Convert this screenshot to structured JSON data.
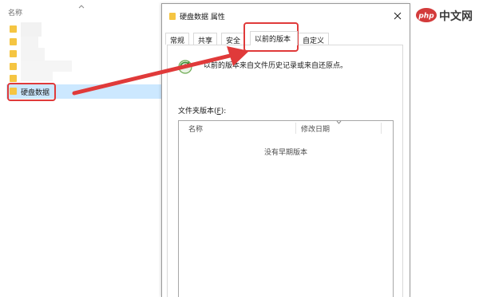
{
  "explorer": {
    "column_header": "名称",
    "selected_folder": "硬盘数据"
  },
  "dialog": {
    "title": "硬盘数据 属性",
    "tabs": [
      {
        "label": "常规"
      },
      {
        "label": "共享"
      },
      {
        "label": "安全"
      },
      {
        "label": "以前的版本"
      },
      {
        "label": "自定义"
      }
    ],
    "active_tab": "以前的版本",
    "info_text": "以前的版本来自文件历史记录或来自还原点。",
    "list_label_prefix": "文件夹版本(",
    "list_label_accel": "F",
    "list_label_suffix": "):",
    "columns": [
      "名称",
      "修改日期"
    ],
    "empty_message": "没有早期版本"
  },
  "watermark": {
    "text": "中文网",
    "logo_text": "php"
  },
  "colors": {
    "annotation_red": "#e03a3a",
    "folder_yellow": "#f5c542",
    "selection_blue": "#cce8ff"
  }
}
